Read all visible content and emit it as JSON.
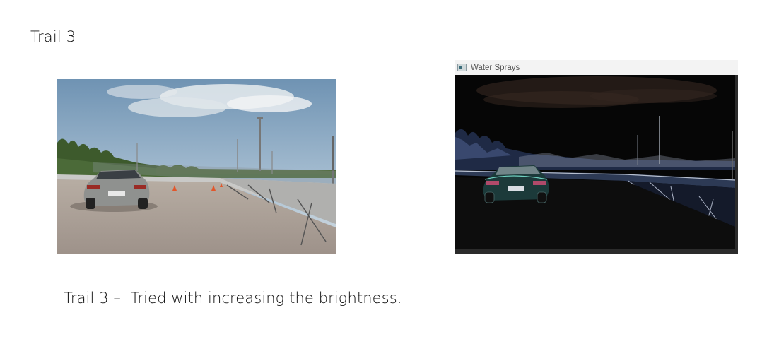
{
  "slide": {
    "title": "Trail 3",
    "caption": "Trail 3 –  Tried with increasing the brightness."
  },
  "window": {
    "title": "Water Sprays",
    "icon": "app-window-icon"
  },
  "images": {
    "original": {
      "description_icon": "race-car-track-photo"
    },
    "processed": {
      "description_icon": "processed-track-photo"
    }
  }
}
